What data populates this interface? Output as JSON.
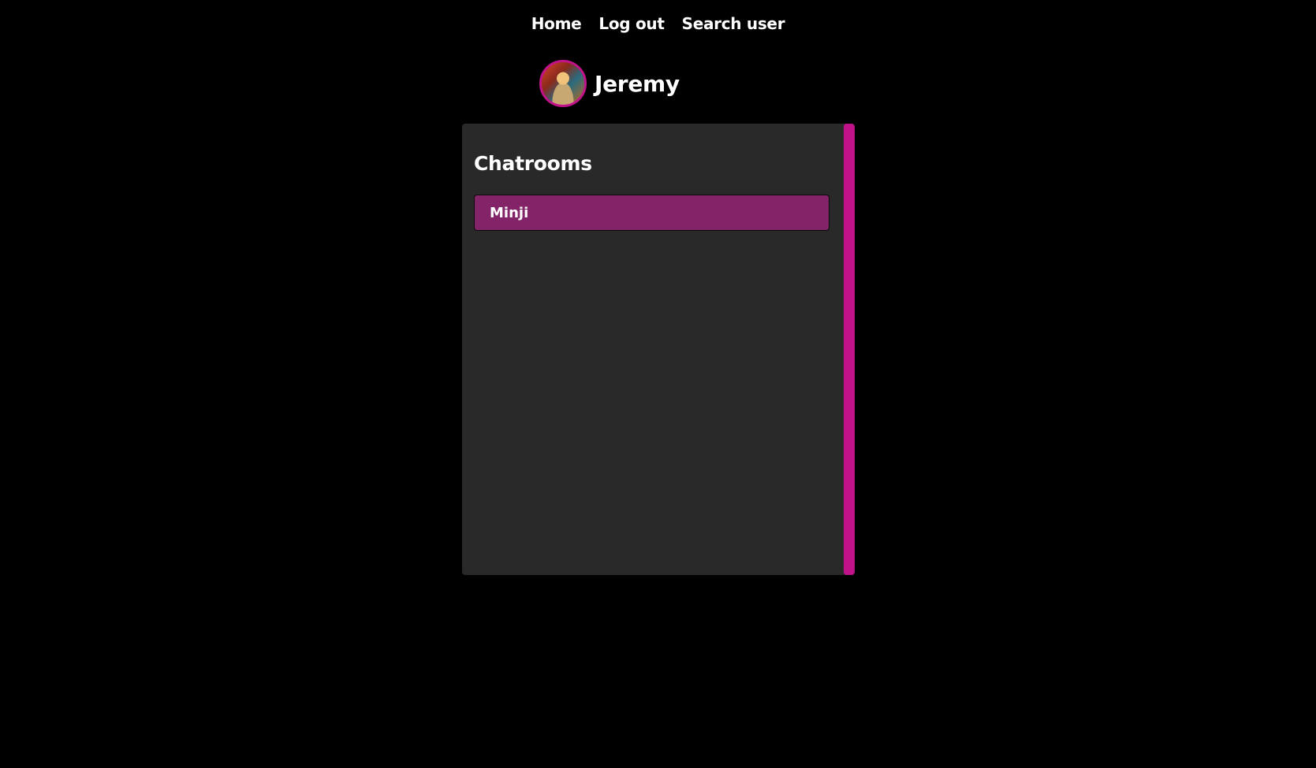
{
  "nav": {
    "home": "Home",
    "logout": "Log out",
    "search": "Search user"
  },
  "profile": {
    "username": "Jeremy",
    "avatar_icon": "user-avatar-photo"
  },
  "chatrooms": {
    "title": "Chatrooms",
    "rooms": [
      {
        "name": "Minji"
      }
    ]
  },
  "colors": {
    "background": "#000000",
    "panel": "#2a292a",
    "accent": "#c0138a",
    "room_item": "#832368"
  }
}
